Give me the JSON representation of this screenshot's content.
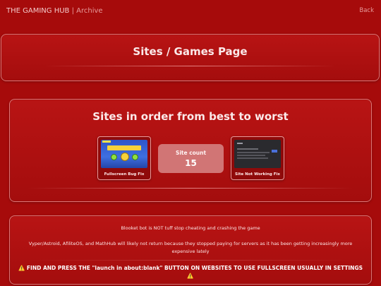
{
  "header": {
    "brand": "THE GAMING HUB",
    "separator": "|",
    "section": "Archive",
    "back_label": "Back"
  },
  "title_panel": {
    "title": "Sites / Games Page"
  },
  "sites_panel": {
    "heading": "Sites in order from best to worst",
    "cards": [
      {
        "label": "Fullscreen Bug Fix"
      },
      {
        "label": "Site Not Working Fix"
      }
    ],
    "count": {
      "label": "Site count",
      "value": "15"
    }
  },
  "notices": {
    "line1": "Blooket bot is NOT tuff stop cheating and crashing the game",
    "line2": "Vyper/Astroid, AfiliteOS, and MathHub will likely not return because they stopped paying for servers as it has been getting increasingly more expensive lately",
    "line3": "⚠️ FIND AND PRESS THE \"launch in about:blank\" BUTTON ON WEBSITES TO USE FULLSCREEN USUALLY IN SETTINGS ⚠️"
  },
  "colors": {
    "background": "#a60b0b",
    "panel_border": "#f2b3b3",
    "count_box": "#d17575"
  }
}
